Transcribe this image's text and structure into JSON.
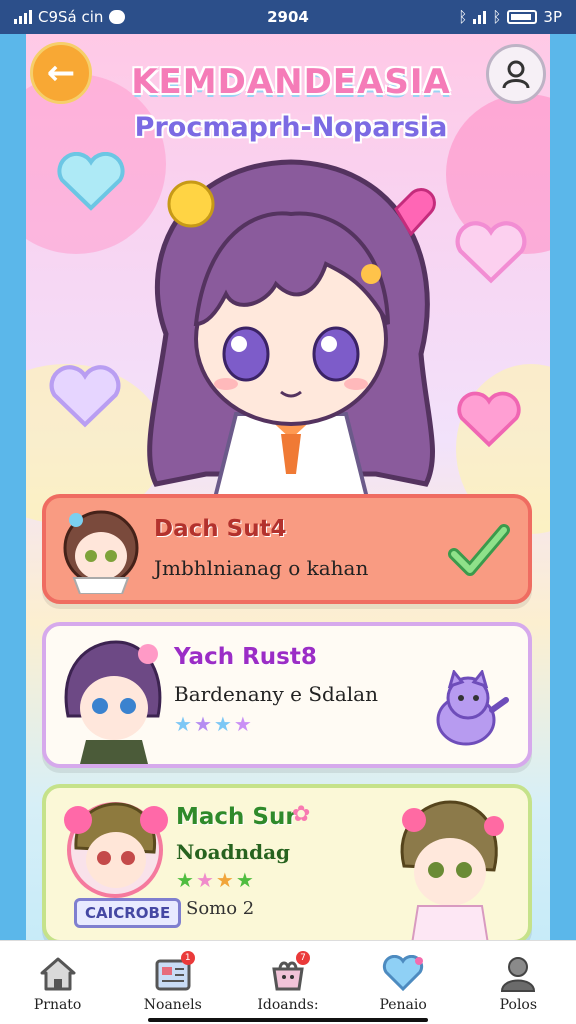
{
  "status_bar": {
    "carrier": "C9Sá cin",
    "time": "2904",
    "battery": "3P"
  },
  "header": {
    "title": "KEMDANDEASIA",
    "subtitle": "Procmaprh-Noparsia",
    "back_icon": "arrow-left-icon",
    "profile_icon": "user-icon"
  },
  "cards": [
    {
      "title": "Dach Sut4",
      "subtitle": "Jmbhlnianag o kahan",
      "action_icon": "checkmark-arrow-icon"
    },
    {
      "title": "Yach Rust8",
      "subtitle": "Bardenany e Sdalan",
      "stars": 4,
      "companion_icon": "purple-cat-icon"
    },
    {
      "title": "Mach Sur",
      "subtitle": "Noadndag",
      "stars": 4,
      "tag": "CAICROBE",
      "count": "Somo 2"
    }
  ],
  "bottom_nav": [
    {
      "label": "Prnato",
      "icon": "home-icon",
      "badge": ""
    },
    {
      "label": "Noanels",
      "icon": "news-card-icon",
      "badge": "1"
    },
    {
      "label": "Idoands:",
      "icon": "gift-box-icon",
      "badge": "7"
    },
    {
      "label": "Penaio",
      "icon": "heart-icon",
      "badge": ""
    },
    {
      "label": "Polos",
      "icon": "profile-icon",
      "badge": ""
    }
  ],
  "colors": {
    "accent_orange": "#f8a834",
    "title_pink": "#f57cb8",
    "subtitle_purple": "#7b6ae3",
    "card1_bg": "#f99b82",
    "card2_border": "#d6a9ec",
    "card3_border": "#c5e28a"
  }
}
